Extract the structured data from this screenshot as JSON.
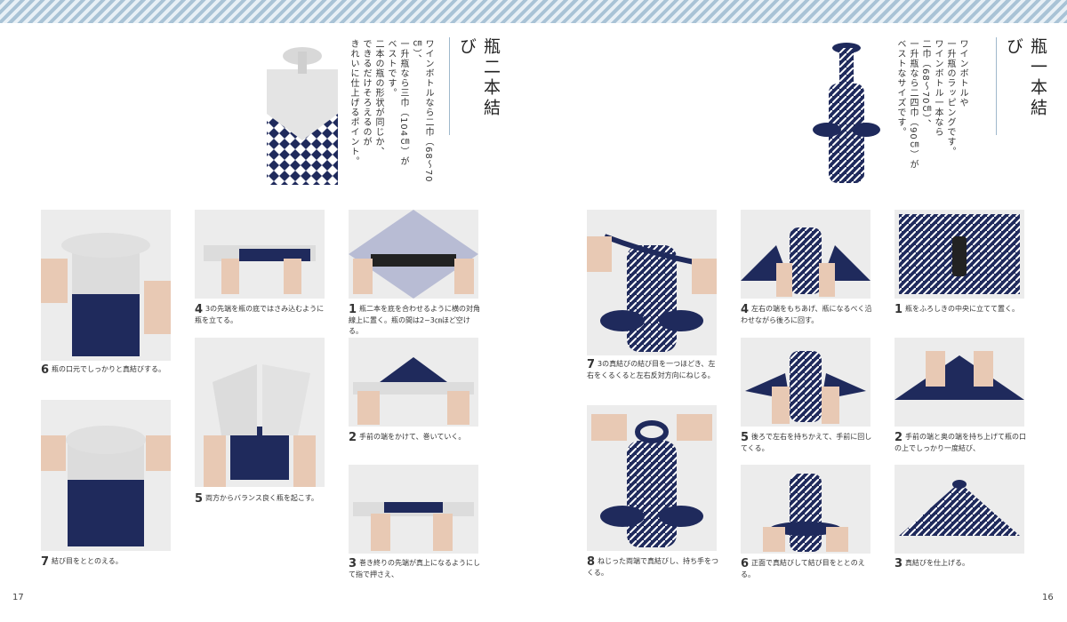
{
  "left_page": {
    "title": "瓶二本結び",
    "intro": [
      "ワインボトルなら二巾（68～70㎝）、",
      "一升瓶なら三巾（104㎝）が",
      "ベストです。",
      "二本の瓶の形状が同じか、",
      "できるだけそろえるのが",
      "きれいに仕上げるポイント。"
    ],
    "page_number": "17",
    "steps": [
      {
        "num": "1",
        "text": "瓶二本を底を合わせるように横の対角線上に置く。瓶の間は2~3㎝ほど空ける。"
      },
      {
        "num": "2",
        "text": "手前の端をかけて、巻いていく。"
      },
      {
        "num": "3",
        "text": "巻き終りの先端が真上になるようにして指で押さえ、"
      },
      {
        "num": "4",
        "text": "3の先端を瓶の底ではさみ込むように瓶を立てる。"
      },
      {
        "num": "5",
        "text": "両方からバランス良く瓶を起こす。"
      },
      {
        "num": "6",
        "text": "瓶の口元でしっかりと真結びする。"
      },
      {
        "num": "7",
        "text": "結び目をととのえる。"
      }
    ]
  },
  "right_page": {
    "title": "瓶一本結び",
    "intro": [
      "ワインボトルや",
      "一升瓶のラッピングです。",
      "ワインボトル一本なら",
      "二巾（68～70㎝）、",
      "一升瓶なら二四巾（90㎝）が",
      "ベストなサイズです。"
    ],
    "page_number": "16",
    "steps": [
      {
        "num": "1",
        "text": "瓶をふろしきの中央に立てて置く。"
      },
      {
        "num": "2",
        "text": "手前の端と奥の端を持ち上げて瓶の口の上でしっかり一度結び、"
      },
      {
        "num": "3",
        "text": "真結びを仕上げる。"
      },
      {
        "num": "4",
        "text": "左右の端をもちあげ、瓶になるべく沿わせながら後ろに回す。"
      },
      {
        "num": "5",
        "text": "後ろで左右を持ちかえて、手前に回してくる。"
      },
      {
        "num": "6",
        "text": "正面で真結びして結び目をととのえる。"
      },
      {
        "num": "7",
        "text": "3の真結びの結び目を一つほどき、左右をくるくると左右反対方向にねじる。"
      },
      {
        "num": "8",
        "text": "ねじった両端で真結びし、持ち手をつくる。"
      }
    ]
  },
  "colors": {
    "navy": "#1f2a5c",
    "band": "#a9c3d6",
    "photo_bg": "#eeeeee"
  }
}
